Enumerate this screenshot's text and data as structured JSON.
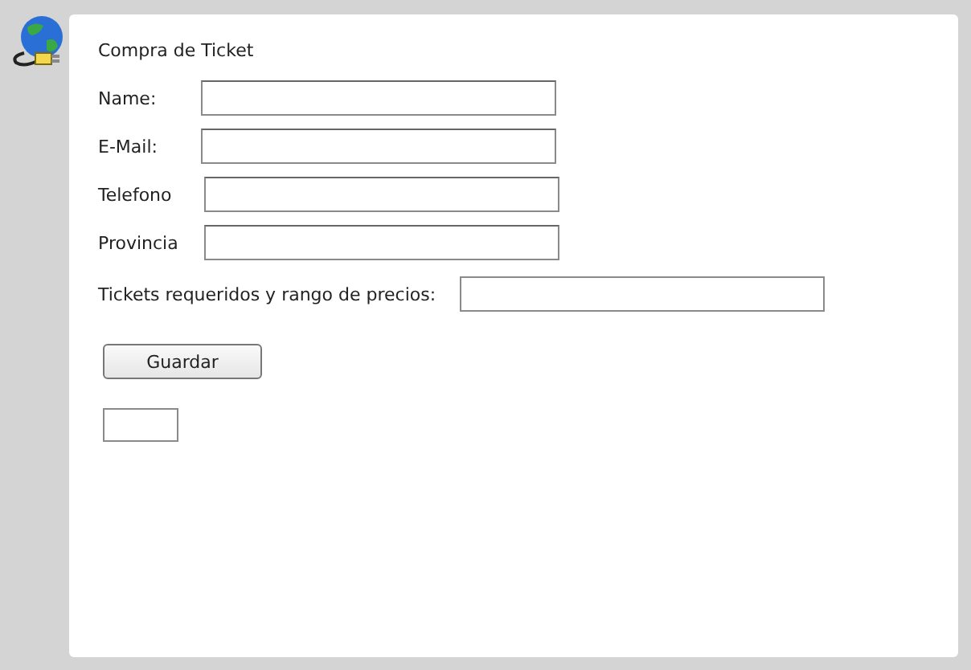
{
  "title": "Compra de Ticket",
  "fields": [
    {
      "label": "Name:"
    },
    {
      "label": "E-Mail:"
    },
    {
      "label": "Telefono"
    },
    {
      "label": "Provincia"
    }
  ],
  "tickets_field": {
    "label": "Tickets requeridos y rango de precios:"
  },
  "buttons": [
    "Guardar"
  ]
}
